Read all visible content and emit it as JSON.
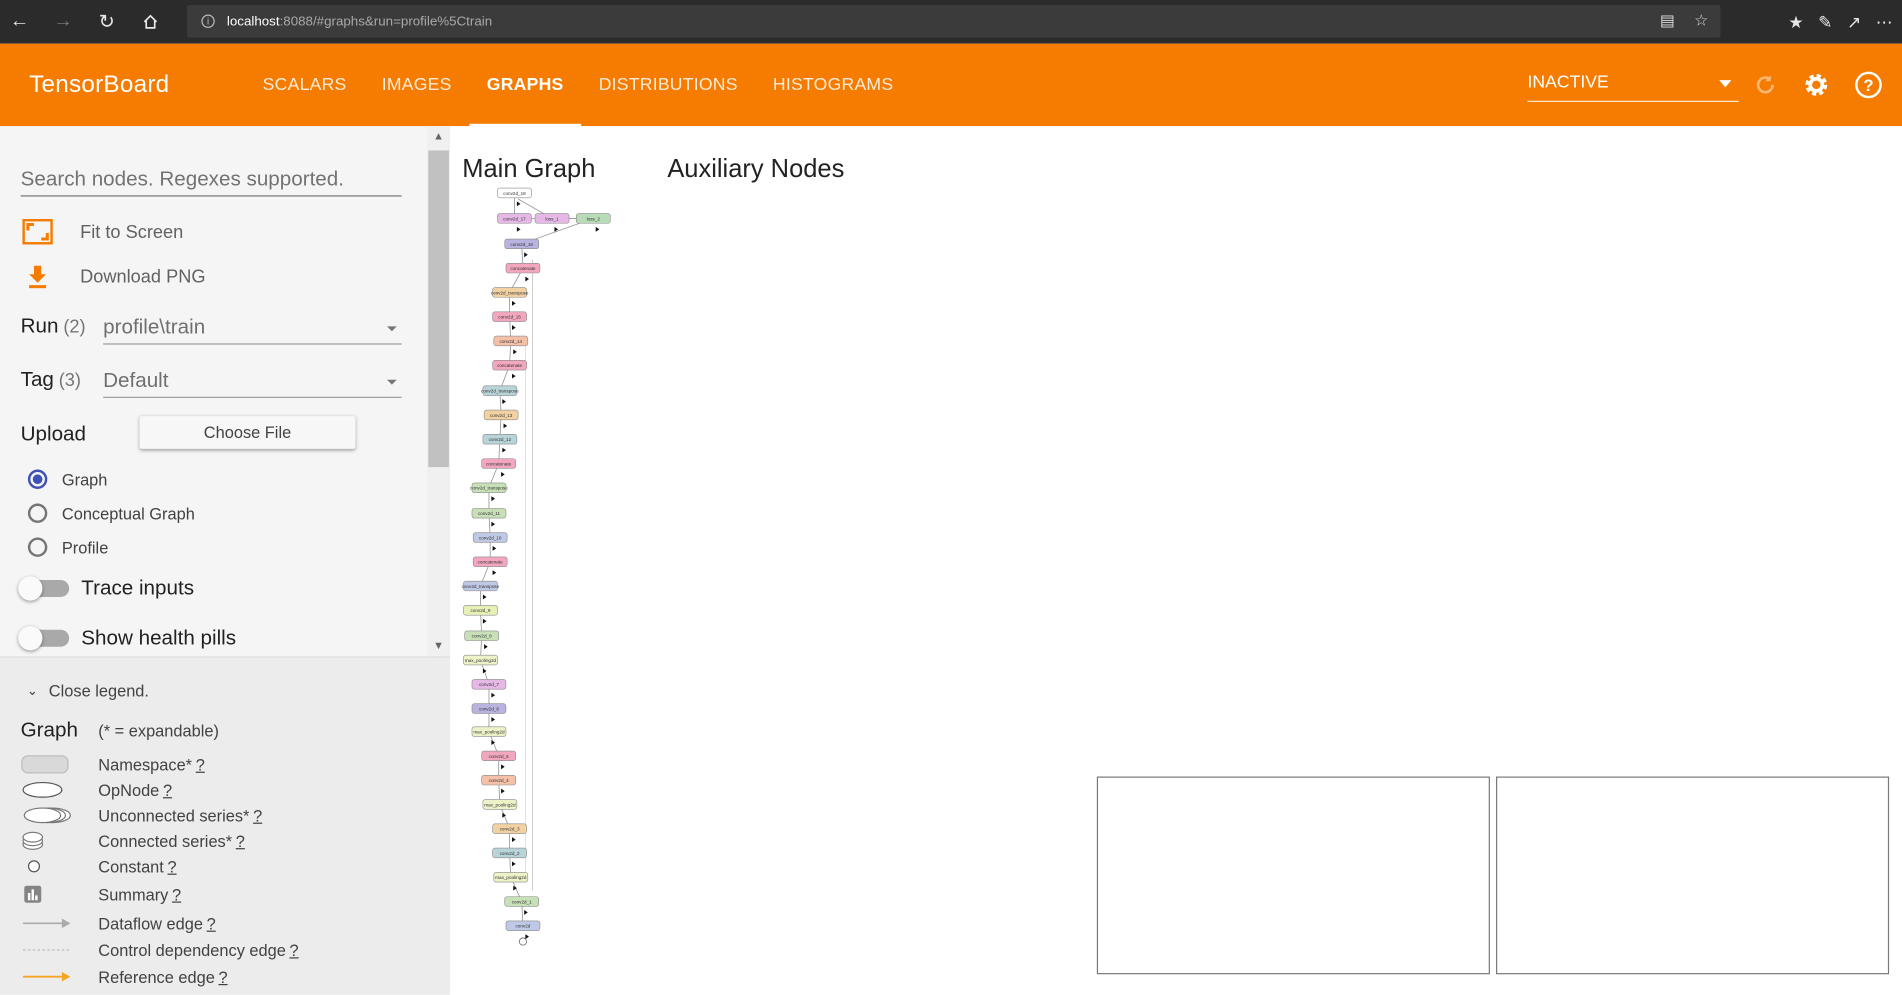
{
  "browser": {
    "url_host": "localhost",
    "url_rest": ":8088/#graphs&run=profile%5Ctrain"
  },
  "header": {
    "brand": "TensorBoard",
    "tabs": [
      "SCALARS",
      "IMAGES",
      "GRAPHS",
      "DISTRIBUTIONS",
      "HISTOGRAMS"
    ],
    "active_tab": "GRAPHS",
    "run_status": "INACTIVE",
    "accent_color": "#f57c00"
  },
  "sidebar": {
    "search_placeholder": "Search nodes. Regexes supported.",
    "fit_label": "Fit to Screen",
    "download_label": "Download PNG",
    "run_label": "Run",
    "run_count": "(2)",
    "run_value": "profile\\train",
    "tag_label": "Tag",
    "tag_count": "(3)",
    "tag_value": "Default",
    "upload_label": "Upload",
    "choose_file": "Choose File",
    "radios": [
      "Graph",
      "Conceptual Graph",
      "Profile"
    ],
    "selected_radio": "Graph",
    "trace_inputs": "Trace inputs",
    "show_health_pills": "Show health pills"
  },
  "legend": {
    "close": "Close legend.",
    "title": "Graph",
    "note": "(* = expandable)",
    "items": [
      "Namespace*",
      "OpNode",
      "Unconnected series*",
      "Connected series*",
      "Constant",
      "Summary",
      "Dataflow edge",
      "Control dependency edge",
      "Reference edge"
    ],
    "help": "?"
  },
  "canvas": {
    "main_graph": "Main Graph",
    "aux_nodes": "Auxiliary Nodes"
  },
  "graph_nodes": [
    {
      "label": "conv2d_18",
      "color": "#ffffff"
    },
    {
      "label": "conv2d_17",
      "color": "#e6b8e6"
    },
    {
      "label": "loss_1",
      "color": "#e6b8e6"
    },
    {
      "label": "loss_2",
      "color": "#b8dcb8"
    },
    {
      "label": "conv2d_16",
      "color": "#b9b3e0"
    },
    {
      "label": "concatenate",
      "color": "#f2a7bf"
    },
    {
      "label": "conv2d_transpose",
      "color": "#f2d2a3"
    },
    {
      "label": "conv2d_15",
      "color": "#f2a7bf"
    },
    {
      "label": "conv2d_14",
      "color": "#f4c0a8"
    },
    {
      "label": "concatenate",
      "color": "#f2a7bf"
    },
    {
      "label": "conv2d_transpose",
      "color": "#b8d4d8"
    },
    {
      "label": "conv2d_13",
      "color": "#f2d2a3"
    },
    {
      "label": "conv2d_12",
      "color": "#b8d4d8"
    },
    {
      "label": "concatenate",
      "color": "#f2a7bf"
    },
    {
      "label": "conv2d_transpose",
      "color": "#c8e0b8"
    },
    {
      "label": "conv2d_11",
      "color": "#c8e0b8"
    },
    {
      "label": "conv2d_10",
      "color": "#bfc8e4"
    },
    {
      "label": "concatenate",
      "color": "#f2a7bf"
    },
    {
      "label": "conv2d_transpose",
      "color": "#bfc8e4"
    },
    {
      "label": "conv2d_9",
      "color": "#e8f0b8"
    },
    {
      "label": "conv2d_8",
      "color": "#c8e0b8"
    },
    {
      "label": "max_pooling2d",
      "color": "#eef2c8"
    },
    {
      "label": "conv2d_7",
      "color": "#e6b8e6"
    },
    {
      "label": "conv2d_6",
      "color": "#b9b3e0"
    },
    {
      "label": "max_pooling2d",
      "color": "#eef2c8"
    },
    {
      "label": "conv2d_5",
      "color": "#f2a7bf"
    },
    {
      "label": "conv2d_4",
      "color": "#f4c0a8"
    },
    {
      "label": "max_pooling2d",
      "color": "#eef2c8"
    },
    {
      "label": "conv2d_3",
      "color": "#f2d2a3"
    },
    {
      "label": "conv2d_2",
      "color": "#b8d4d8"
    },
    {
      "label": "max_pooling2d",
      "color": "#eef2c8"
    },
    {
      "label": "conv2d_1",
      "color": "#c8e0b8"
    },
    {
      "label": "conv2d",
      "color": "#bfc8e4"
    }
  ]
}
